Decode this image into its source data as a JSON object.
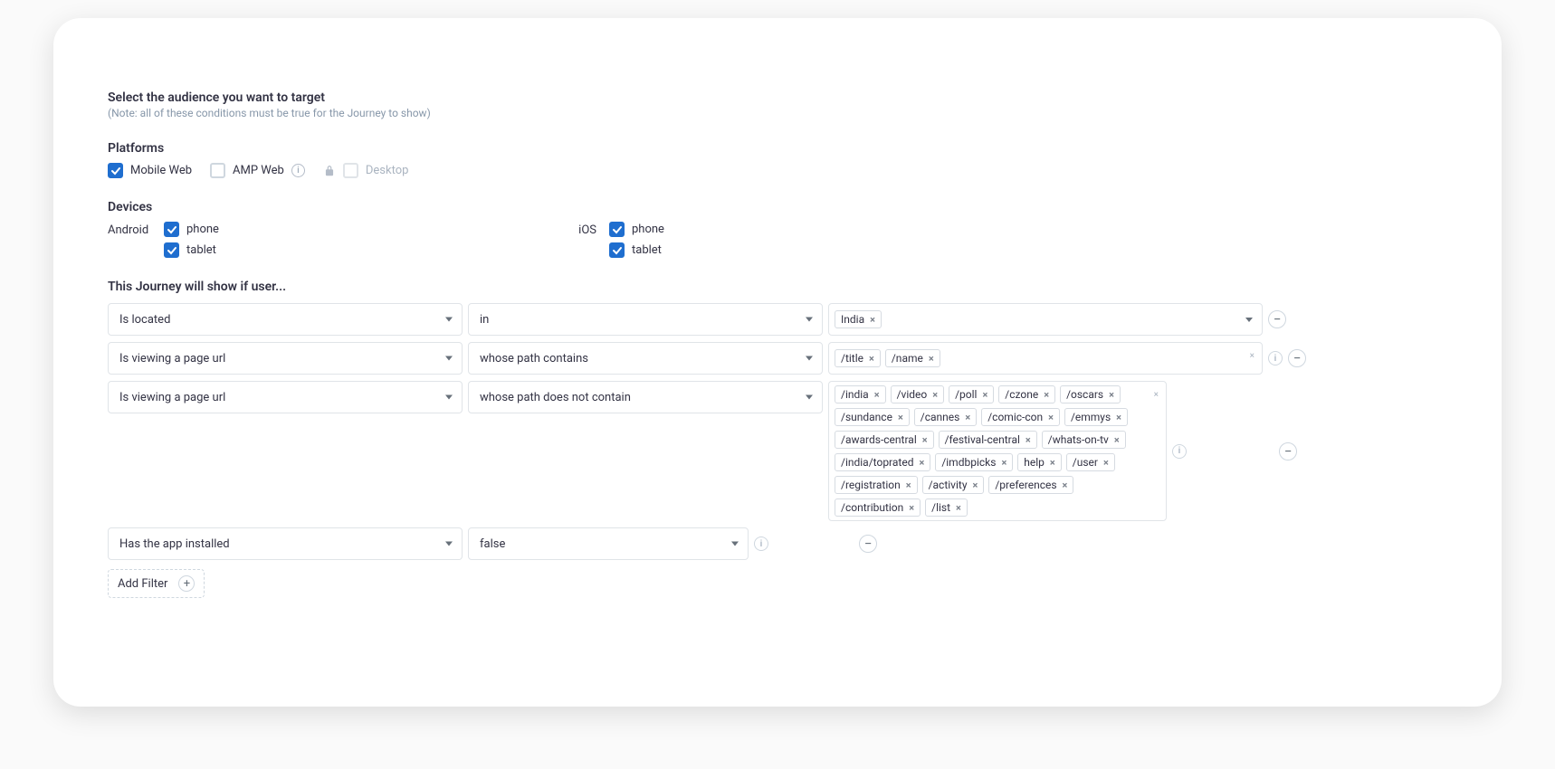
{
  "header": {
    "title": "Select the audience you want to target",
    "note": "(Note: all of these conditions must be true for the Journey to show)"
  },
  "platforms": {
    "label": "Platforms",
    "mobile_web": {
      "label": "Mobile Web",
      "checked": true
    },
    "amp_web": {
      "label": "AMP Web",
      "checked": false
    },
    "desktop": {
      "label": "Desktop",
      "checked": false,
      "locked": true
    }
  },
  "devices": {
    "label": "Devices",
    "android": {
      "label": "Android",
      "phone": {
        "label": "phone",
        "checked": true
      },
      "tablet": {
        "label": "tablet",
        "checked": true
      }
    },
    "ios": {
      "label": "iOS",
      "phone": {
        "label": "phone",
        "checked": true
      },
      "tablet": {
        "label": "tablet",
        "checked": true
      }
    }
  },
  "conditions": {
    "label": "This Journey will show if user...",
    "rows": [
      {
        "field": "Is located",
        "op": "in",
        "tags": [
          "India"
        ],
        "has_caret": true
      },
      {
        "field": "Is viewing a page url",
        "op": "whose path contains",
        "tags": [
          "/title",
          "/name"
        ],
        "has_info": true
      },
      {
        "field": "Is viewing a page url",
        "op": "whose path does not contain",
        "tags": [
          "/india",
          "/video",
          "/poll",
          "/czone",
          "/oscars",
          "/sundance",
          "/cannes",
          "/comic-con",
          "/emmys",
          "/awards-central",
          "/festival-central",
          "/whats-on-tv",
          "/india/toprated",
          "/imdbpicks",
          "help",
          "/user",
          "/registration",
          "/activity",
          "/preferences",
          "/contribution",
          "/list"
        ],
        "has_info": true
      },
      {
        "field": "Has the app installed",
        "op": "false",
        "op_short": true,
        "tags": null,
        "has_info_inline": true
      }
    ],
    "add_filter": "Add Filter"
  }
}
